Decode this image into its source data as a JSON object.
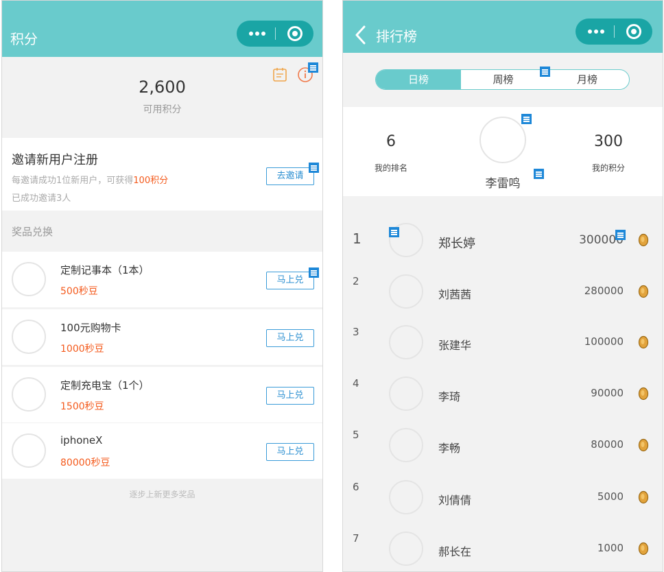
{
  "left_screen": {
    "nav_title": "积分",
    "points": {
      "value": "2,600",
      "label": "可用积分"
    },
    "invite": {
      "title": "邀请新用户注册",
      "desc_prefix": "每邀请成功1位新用户，可获得",
      "desc_highlight": "100积分",
      "count_text": "已成功邀请3人",
      "button": "去邀请"
    },
    "prizes_section_title": "奖品兑换",
    "prizes": [
      {
        "name": "定制记事本（1本）",
        "price": "500秒豆",
        "button": "马上兑"
      },
      {
        "name": "100元购物卡",
        "price": "1000秒豆",
        "button": "马上兑"
      },
      {
        "name": "定制充电宝（1个）",
        "price": "1500秒豆",
        "button": "马上兑"
      },
      {
        "name": "iphoneX",
        "price": "80000秒豆",
        "button": "马上兑"
      }
    ],
    "more_hint": "逐步上新更多奖品"
  },
  "right_screen": {
    "nav_title": "排行榜",
    "tabs": [
      {
        "label": "日榜",
        "active": true
      },
      {
        "label": "周榜",
        "active": false
      },
      {
        "label": "月榜",
        "active": false
      }
    ],
    "my": {
      "rank_value": "6",
      "rank_label": "我的排名",
      "name": "李雷鸣",
      "points_value": "300",
      "points_label": "我的积分"
    },
    "ranking": [
      {
        "rank": "1",
        "name": "郑长婷",
        "score": "300000"
      },
      {
        "rank": "2",
        "name": "刘茜茜",
        "score": "280000"
      },
      {
        "rank": "3",
        "name": "张建华",
        "score": "100000"
      },
      {
        "rank": "4",
        "name": "李琦",
        "score": "90000"
      },
      {
        "rank": "5",
        "name": "李畅",
        "score": "80000"
      },
      {
        "rank": "6",
        "name": "刘倩倩",
        "score": "5000"
      },
      {
        "rank": "7",
        "name": "郝长在",
        "score": "1000"
      }
    ]
  },
  "colors": {
    "nav_bar": "#69cbcc",
    "capsule": "#1aa5a5",
    "highlight": "#f45a1c",
    "button_border": "#3a9bd8",
    "annotation_marker": "#1e88d8",
    "coin": "#e2a33c"
  },
  "icons": {
    "capsule_more": "more-dots-icon",
    "capsule_close": "target-circle-icon",
    "calendar": "calendar-icon",
    "info": "info-icon",
    "back": "chevron-left-icon",
    "coin": "coin-icon",
    "annotation": "note-marker-icon"
  }
}
